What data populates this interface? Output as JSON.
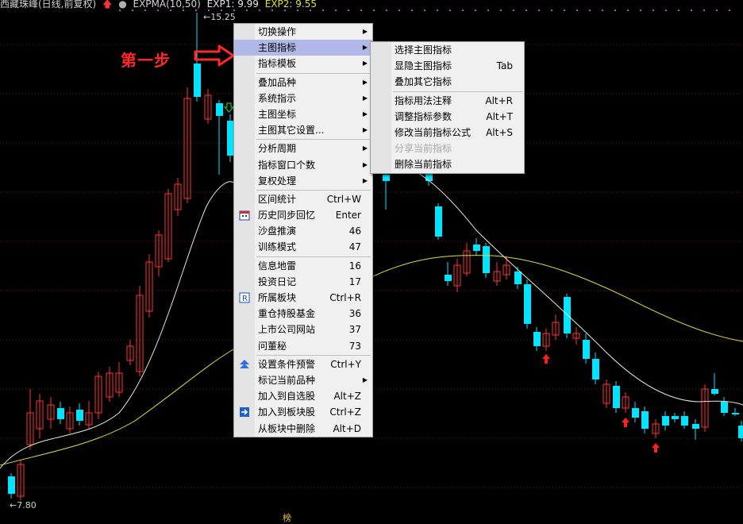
{
  "header": {
    "title": "西藏珠峰(日线,前复权)",
    "indicator": "EXPMA(10,50)",
    "exp1_label": "EXP1: 9.99",
    "exp2_label": "EXP2: 9.55"
  },
  "chart_labels": {
    "high": "15.25",
    "low": "7.80",
    "bottom_mark": "榜"
  },
  "annotation": {
    "step_text": "第一步"
  },
  "colors": {
    "up": "#ff3232",
    "down": "#00e4ff",
    "exp1": "#e6e6e6",
    "exp2": "#e0e020",
    "menu_highlight": "#b0b8e8",
    "step": "#ff2828"
  },
  "context_menu": {
    "items": [
      {
        "label": "切换操作",
        "submenu": true
      },
      {
        "label": "主图指标",
        "submenu": true,
        "highlighted": true
      },
      {
        "label": "指标模板",
        "submenu": true
      },
      {
        "sep": true
      },
      {
        "label": "叠加品种",
        "submenu": true
      },
      {
        "label": "系统指示",
        "submenu": true
      },
      {
        "label": "主图坐标",
        "submenu": true
      },
      {
        "label": "主图其它设置...",
        "submenu": true
      },
      {
        "sep": true
      },
      {
        "label": "分析周期",
        "submenu": true
      },
      {
        "label": "指标窗口个数",
        "submenu": true
      },
      {
        "label": "复权处理",
        "submenu": true
      },
      {
        "sep": true
      },
      {
        "label": "区间统计",
        "shortcut": "Ctrl+W"
      },
      {
        "label": "历史同步回忆",
        "shortcut": "Enter",
        "icon": "calendar-icon"
      },
      {
        "label": "沙盘推演",
        "shortcut": "46"
      },
      {
        "label": "训练模式",
        "shortcut": "47"
      },
      {
        "sep": true
      },
      {
        "label": "信息地雷",
        "shortcut": "16"
      },
      {
        "label": "投资日记",
        "shortcut": "17"
      },
      {
        "label": "所属板块",
        "shortcut": "Ctrl+R",
        "icon": "r-box-icon"
      },
      {
        "label": "重仓持股基金",
        "shortcut": "36"
      },
      {
        "label": "上市公司网站",
        "shortcut": "37"
      },
      {
        "label": "问董秘",
        "shortcut": "73"
      },
      {
        "sep": true
      },
      {
        "label": "设置条件预警",
        "shortcut": "Ctrl+Y",
        "icon": "alert-up-icon"
      },
      {
        "label": "标记当前品种",
        "submenu": true
      },
      {
        "label": "加入到自选股",
        "shortcut": "Alt+Z"
      },
      {
        "label": "加入到板块股",
        "shortcut": "Ctrl+Z",
        "icon": "add-to-block-icon"
      },
      {
        "label": "从板块中删除",
        "shortcut": "Alt+D"
      }
    ]
  },
  "submenu_main_indicator": {
    "items": [
      {
        "label": "选择主图指标"
      },
      {
        "label": "显隐主图指标",
        "shortcut": "Tab"
      },
      {
        "label": "叠加其它指标"
      },
      {
        "sep": true
      },
      {
        "label": "指标用法注释",
        "shortcut": "Alt+R"
      },
      {
        "label": "调整指标参数",
        "shortcut": "Alt+T"
      },
      {
        "label": "修改当前指标公式",
        "shortcut": "Alt+S"
      },
      {
        "label": "分享当前指标",
        "disabled": true
      },
      {
        "label": "删除当前指标"
      }
    ]
  }
}
